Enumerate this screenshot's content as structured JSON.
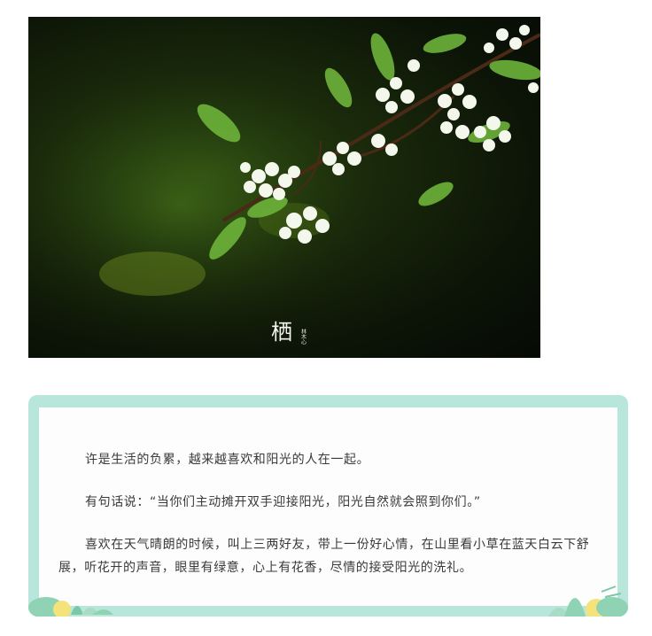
{
  "photo": {
    "alt": "white blossoms on a green branch",
    "watermark_glyph": "栖",
    "watermark_side": "林木心"
  },
  "article": {
    "paragraphs": [
      "许是生活的负累，越来越喜欢和阳光的人在一起。",
      "有句话说：“当你们主动摊开双手迎接阳光，阳光自然就会照到你们。”",
      "喜欢在天气晴朗的时候，叫上三两好友，带上一份好心情，在山里看小草在蓝天白云下舒展，听花开的声音，眼里有绿意，心上有花香，尽情的接受阳光的洗礼。"
    ]
  },
  "colors": {
    "card_border": "#b9e6da",
    "text": "#3a3a3a",
    "leaf": "#8fd3b4",
    "sun": "#f3e37a"
  }
}
